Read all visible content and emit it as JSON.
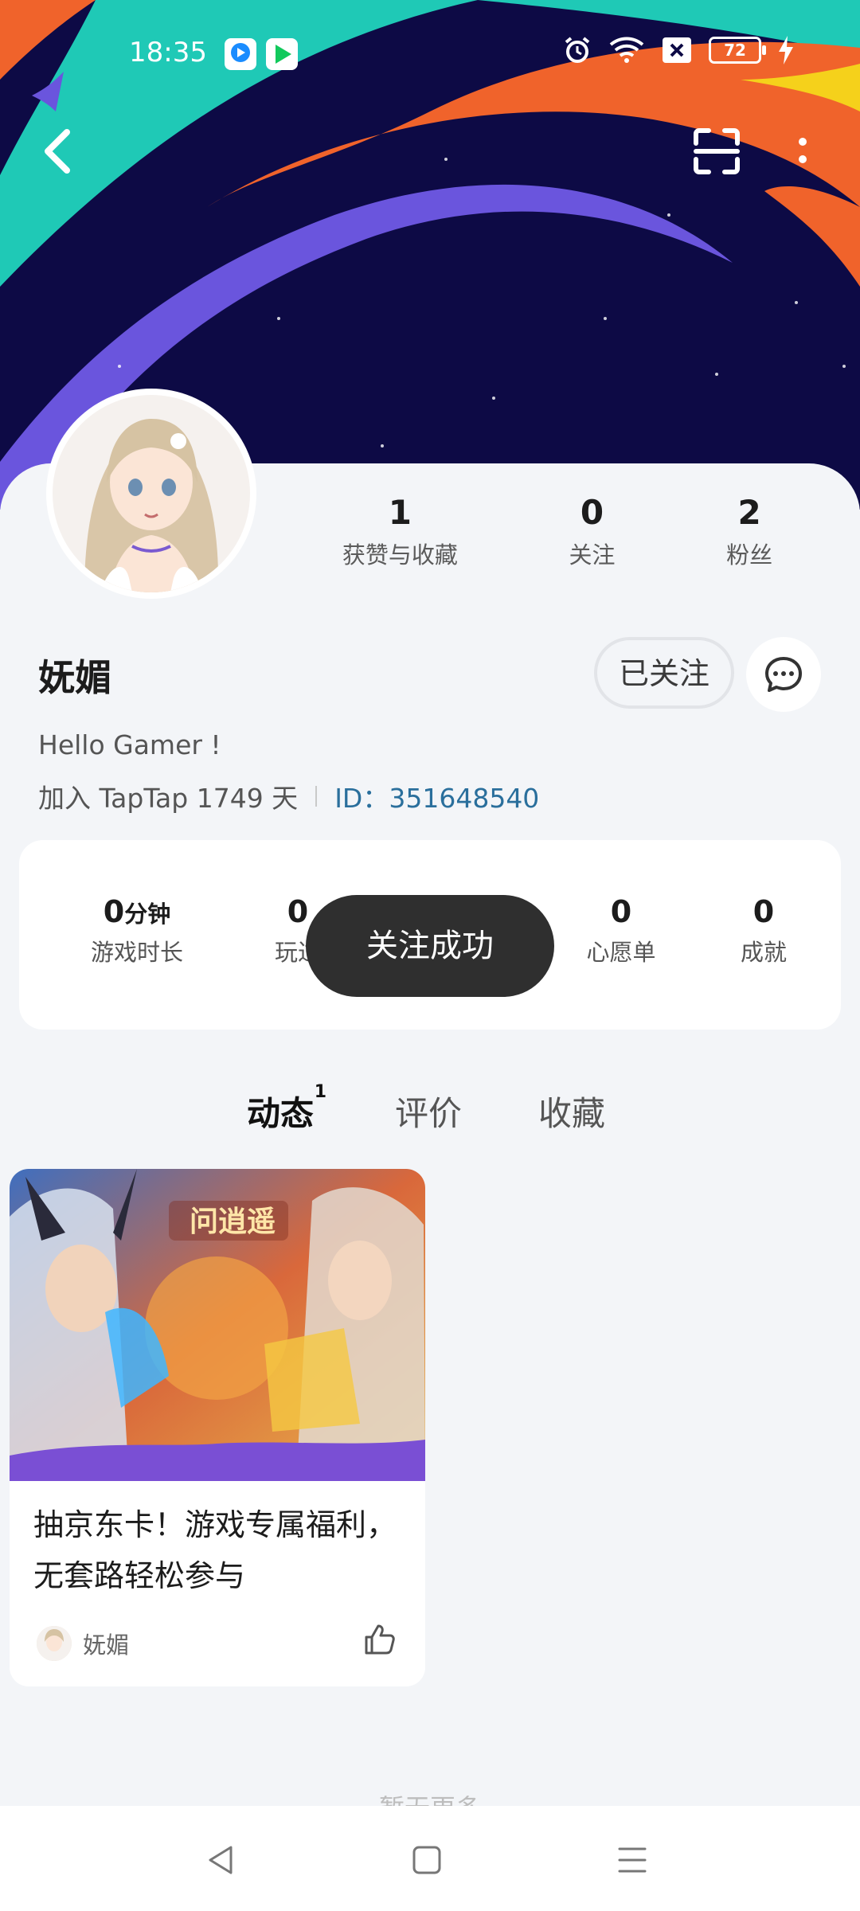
{
  "status_bar": {
    "time": "18:35",
    "battery": "72",
    "icons": [
      "tencent-video-app-icon",
      "iqiyi-app-icon",
      "alarm-icon",
      "wifi-icon",
      "sim-off-icon",
      "battery-icon",
      "charging-icon"
    ]
  },
  "header": {
    "back_icon": "chevron-left-icon",
    "scan_icon": "scan-icon",
    "more_icon": "more-vertical-icon"
  },
  "profile": {
    "name": "妩媚",
    "bio": "Hello Gamer !",
    "joined": "加入 TapTap 1749 天",
    "id_label": "ID：",
    "id_value": "351648540",
    "stats": [
      {
        "num": "1",
        "label": "获赞与收藏"
      },
      {
        "num": "0",
        "label": "关注"
      },
      {
        "num": "2",
        "label": "粉丝"
      }
    ],
    "follow_button": "已关注",
    "message_icon": "chat-bubble-icon"
  },
  "game_stats": {
    "playtime_num": "0",
    "playtime_unit": "分钟",
    "playtime_label": "游戏时长",
    "played_num": "0",
    "played_label": "玩过",
    "wishlist_num": "0",
    "wishlist_label": "心愿单",
    "achievements_num": "0",
    "achievements_label": "成就"
  },
  "toast": "关注成功",
  "tabs": [
    {
      "label": "动态",
      "badge": "1"
    },
    {
      "label": "评价"
    },
    {
      "label": "收藏"
    }
  ],
  "post": {
    "title": "抽京东卡！游戏专属福利，无套路轻松参与",
    "author": "妩媚",
    "game_logo": "问逍遥"
  },
  "footer_hint": "暂无更多",
  "colors": {
    "banner_bg": "#0d0a45",
    "stripe_teal": "#1fc9b6",
    "stripe_orange": "#f0632b",
    "stripe_purple": "#6a55dd",
    "accent": "#3ad6c4",
    "link": "#2a6f9c"
  }
}
